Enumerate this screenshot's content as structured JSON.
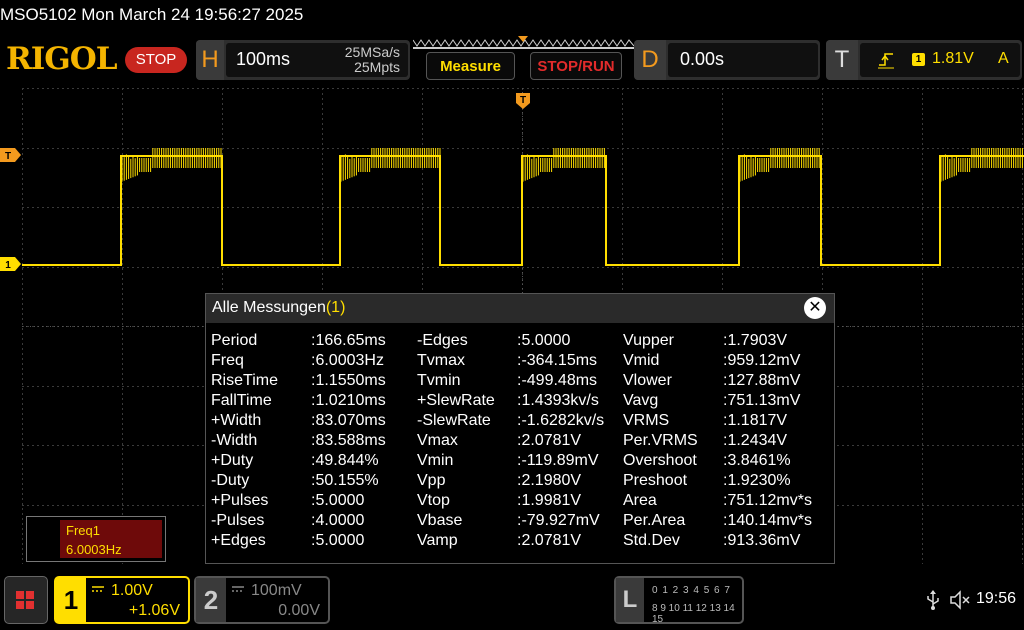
{
  "window_title": "MSO5102  Mon March 24 19:56:27 2025",
  "brand": "RIGOL",
  "status": "STOP",
  "horizontal": {
    "letter": "H",
    "timebase": "100ms",
    "sample_rate": "25MSa/s",
    "memory_depth": "25Mpts"
  },
  "buttons": {
    "measure": "Measure",
    "stop_run": "STOP/RUN"
  },
  "delay": {
    "letter": "D",
    "value": "0.00s"
  },
  "trigger": {
    "letter": "T",
    "source": "1",
    "level": "1.81V",
    "mode": "A"
  },
  "markers": {
    "trigger_level": "T",
    "channel1": "1",
    "trigger_position": "T"
  },
  "measure_panel": {
    "title": "Alle Messungen",
    "count": "(1)",
    "columns": [
      [
        {
          "name": "Period",
          "value": ":166.65ms"
        },
        {
          "name": "Freq",
          "value": ":6.0003Hz"
        },
        {
          "name": "RiseTime",
          "value": ":1.1550ms"
        },
        {
          "name": "FallTime",
          "value": ":1.0210ms"
        },
        {
          "name": "+Width",
          "value": ":83.070ms"
        },
        {
          "name": "-Width",
          "value": ":83.588ms"
        },
        {
          "name": "+Duty",
          "value": ":49.844%"
        },
        {
          "name": "-Duty",
          "value": ":50.155%"
        },
        {
          "name": "+Pulses",
          "value": ":5.0000"
        },
        {
          "name": "-Pulses",
          "value": ":4.0000"
        },
        {
          "name": "+Edges",
          "value": ":5.0000"
        }
      ],
      [
        {
          "name": "-Edges",
          "value": ":5.0000"
        },
        {
          "name": "Tvmax",
          "value": ":-364.15ms"
        },
        {
          "name": "Tvmin",
          "value": ":-499.48ms"
        },
        {
          "name": "+SlewRate",
          "value": ":1.4393kv/s"
        },
        {
          "name": "-SlewRate",
          "value": ":-1.6282kv/s"
        },
        {
          "name": "Vmax",
          "value": ":2.0781V"
        },
        {
          "name": "Vmin",
          "value": ":-119.89mV"
        },
        {
          "name": "Vpp",
          "value": ":2.1980V"
        },
        {
          "name": "Vtop",
          "value": ":1.9981V"
        },
        {
          "name": "Vbase",
          "value": ":-79.927mV"
        },
        {
          "name": "Vamp",
          "value": ":2.0781V"
        }
      ],
      [
        {
          "name": "Vupper",
          "value": ":1.7903V"
        },
        {
          "name": "Vmid",
          "value": ":959.12mV"
        },
        {
          "name": "Vlower",
          "value": ":127.88mV"
        },
        {
          "name": "Vavg",
          "value": ":751.13mV"
        },
        {
          "name": "VRMS",
          "value": ":1.1817V"
        },
        {
          "name": "Per.VRMS",
          "value": ":1.2434V"
        },
        {
          "name": "Overshoot",
          "value": ":3.8461%"
        },
        {
          "name": "Preshoot",
          "value": ":1.9230%"
        },
        {
          "name": "Area",
          "value": ":751.12mv*s"
        },
        {
          "name": "Per.Area",
          "value": ":140.14mv*s"
        },
        {
          "name": "Std.Dev",
          "value": ":913.36mV"
        }
      ]
    ]
  },
  "freq_readout": {
    "label": "Freq1",
    "value": "6.0003Hz"
  },
  "channels": [
    {
      "num": "1",
      "scale": "1.00V",
      "offset": "+1.06V",
      "color": "#ffde00"
    },
    {
      "num": "2",
      "scale": "100mV",
      "offset": "0.00V",
      "color": "#888888"
    }
  ],
  "logic": {
    "letter": "L",
    "row1": "0 1 2 3  4 5 6 7",
    "row2": "8 9 10 11 12 13 14 15"
  },
  "clock": "19:56",
  "icons": {
    "usb": "usb-icon",
    "speaker": "speaker-muted-icon",
    "menu": "menu-grid-icon"
  },
  "colors": {
    "accent": "#f39a1e",
    "trace": "#ffde00",
    "stop": "#c8261f"
  }
}
